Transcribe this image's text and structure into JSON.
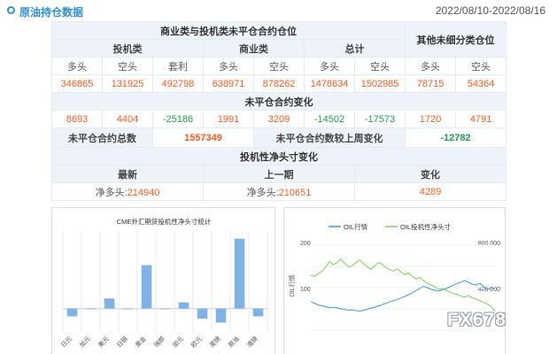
{
  "header": {
    "title": "原油持仓数据",
    "date_range": "2022/08/10-2022/08/16"
  },
  "table": {
    "group_commercial_speculative": "商业类与投机类未平仓合约仓位",
    "group_other": "其他未细分类仓位",
    "sub_speculative": "投机类",
    "sub_commercial": "商业类",
    "sub_total": "总计",
    "col_long": "多头",
    "col_short": "空头",
    "col_spread": "套利",
    "values": {
      "spec_long": "346865",
      "spec_short": "131925",
      "spec_spread": "492798",
      "comm_long": "638971",
      "comm_short": "878262",
      "total_long": "1478634",
      "total_short": "1502985",
      "other_long": "78715",
      "other_short": "54364"
    },
    "oi_change_title": "未平仓合约变化",
    "changes": {
      "spec_long": "8693",
      "spec_short": "4404",
      "spec_spread": "-25186",
      "comm_long": "1991",
      "comm_short": "3209",
      "total_long": "-14502",
      "total_short": "-17573",
      "other_long": "1720",
      "other_short": "4791"
    },
    "total_oi_label": "未平仓合约总数",
    "total_oi_value": "1557349",
    "oi_vs_last_week_label": "未平仓合约数较上周变化",
    "oi_vs_last_week_value": "-12782",
    "net_title": "投机性净头寸变化",
    "net_latest_label": "最新",
    "net_prev_label": "上一期",
    "net_change_label": "变化",
    "net_prefix_latest": "净多头:",
    "net_latest_value": "214940",
    "net_prefix_prev": "净多头:",
    "net_prev_value": "210651",
    "net_change_value": "4289"
  },
  "chart_data": [
    {
      "type": "bar",
      "title": "CME外汇期货投机性净头寸统计",
      "categories": [
        "日元",
        "加元",
        "美元",
        "日银",
        "黄金",
        "瑞郎",
        "加元",
        "欧元",
        "英镑",
        "原油",
        "澳镑"
      ],
      "values": [
        -10,
        0,
        13,
        0,
        56,
        0,
        8,
        -13,
        -18,
        90,
        -10
      ],
      "ylim": [
        -30,
        100
      ],
      "bar_color": "#7fb2e5"
    },
    {
      "type": "line",
      "legend": [
        "OIL行情",
        "OIL投机性净头寸"
      ],
      "ylabel": "OIL行情",
      "y_left_ticks": [
        "200",
        "100"
      ],
      "y_right_ticks": [
        "800 000",
        "400 000"
      ],
      "series": [
        {
          "name": "OIL行情",
          "color": "#3c9ad9",
          "values": [
            70,
            66,
            62,
            60,
            58,
            56,
            57,
            55,
            53,
            52,
            50,
            51,
            49,
            48,
            50,
            52,
            55,
            57,
            60,
            63,
            66,
            69,
            72,
            75,
            78,
            82,
            86,
            90,
            95,
            100,
            105,
            102,
            98,
            96,
            94,
            97,
            100,
            104,
            108,
            112,
            115,
            118,
            114,
            110,
            108,
            112,
            104,
            98,
            102,
            100
          ]
        },
        {
          "name": "OIL投机性净头寸",
          "color": "#7ccf5a",
          "values": [
            130,
            128,
            134,
            140,
            150,
            162,
            155,
            160,
            168,
            158,
            150,
            152,
            160,
            166,
            158,
            150,
            144,
            152,
            160,
            156,
            148,
            144,
            140,
            146,
            138,
            132,
            136,
            128,
            122,
            126,
            118,
            112,
            108,
            104,
            98,
            100,
            96,
            92,
            88,
            86,
            82,
            80,
            84,
            78,
            76,
            72,
            68,
            64,
            58,
            48
          ]
        }
      ]
    }
  ],
  "watermark": "FX678"
}
